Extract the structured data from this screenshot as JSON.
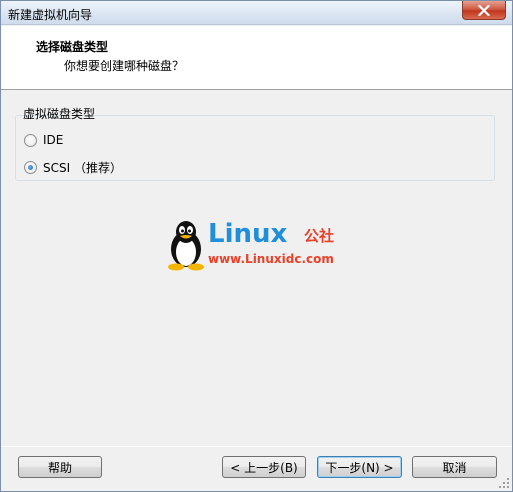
{
  "window": {
    "title": "新建虚拟机向导",
    "close_icon": "close-icon"
  },
  "header": {
    "title": "选择磁盘类型",
    "subtitle": "你想要创建哪种磁盘？"
  },
  "disk_type": {
    "group_label": "虚拟磁盘类型",
    "options": [
      {
        "label": "IDE",
        "checked": false
      },
      {
        "label": "SCSI （推荐）",
        "checked": true
      }
    ]
  },
  "watermark": {
    "brand": "Linux",
    "brand_cn": "公社",
    "url": "www.Linuxidc.com",
    "icon": "tux-penguin-icon",
    "brand_color": "#1f8fdc",
    "accent_color": "#e8412a"
  },
  "buttons": {
    "help": "帮助",
    "back": "< 上一步(B)",
    "next": "下一步(N) >",
    "cancel": "取消"
  }
}
